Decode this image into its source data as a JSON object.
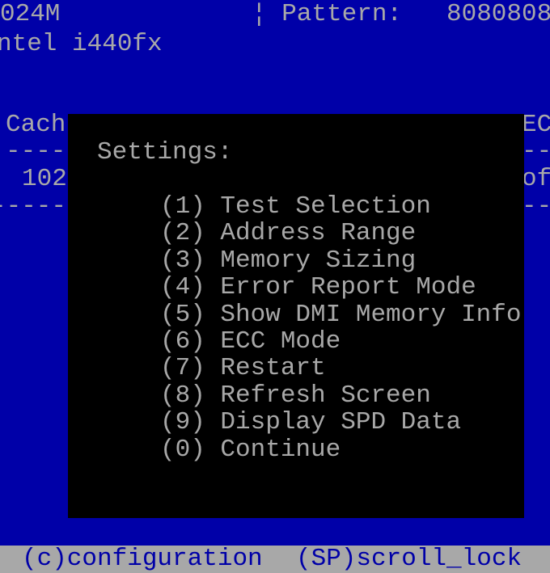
{
  "header": {
    "memory_size": "024M",
    "pattern_label": "¦ Pattern:",
    "pattern_value": "8080808",
    "chipset": "ntel i440fx"
  },
  "table": {
    "left_header": "Cach",
    "right_header": "EC",
    "left_divider": "----",
    "right_divider": "--",
    "left_value": "102",
    "right_value": "of",
    "left_divider2": "-----",
    "right_divider2": "--"
  },
  "settings": {
    "title": "Settings:",
    "items": [
      {
        "key": "(1)",
        "label": "Test Selection"
      },
      {
        "key": "(2)",
        "label": "Address Range"
      },
      {
        "key": "(3)",
        "label": "Memory Sizing"
      },
      {
        "key": "(4)",
        "label": "Error Report Mode"
      },
      {
        "key": "(5)",
        "label": "Show DMI Memory Info"
      },
      {
        "key": "(6)",
        "label": "ECC Mode"
      },
      {
        "key": "(7)",
        "label": "Restart"
      },
      {
        "key": "(8)",
        "label": "Refresh Screen"
      },
      {
        "key": "(9)",
        "label": "Display SPD Data"
      },
      {
        "key": "(0)",
        "label": "Continue"
      }
    ]
  },
  "footer": {
    "configuration": "(c)configuration",
    "scroll_lock": "(SP)scroll_lock"
  },
  "colors": {
    "background": "#0000a8",
    "text": "#a8a8a8",
    "popup": "#000000",
    "footer_bg": "#a8a8a8"
  }
}
